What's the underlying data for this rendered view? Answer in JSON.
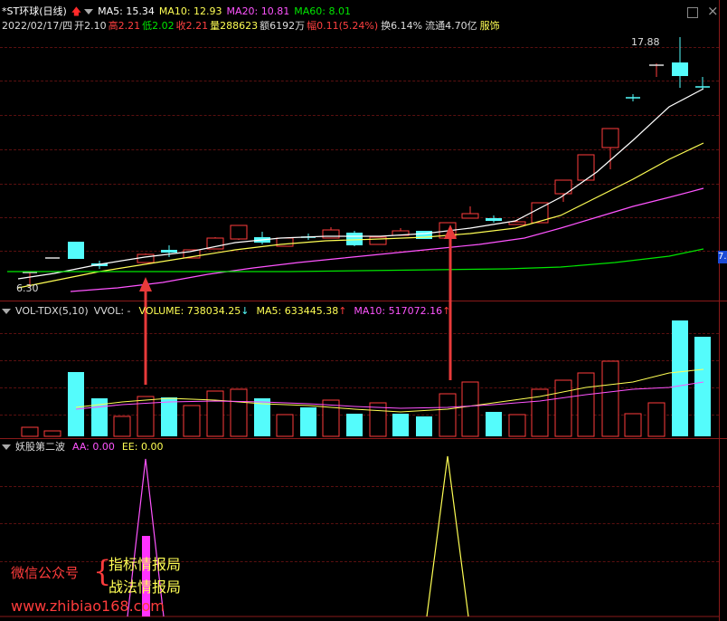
{
  "main": {
    "title": "*ST环球(日线)",
    "ma5": "MA5: 15.34",
    "ma10": "MA10: 12.93",
    "ma20": "MA20: 10.81",
    "ma60": "MA60: 8.01",
    "date": "2022/02/17/四",
    "open": "开2.10",
    "high": "高2.21",
    "low": "低2.02",
    "close": "收2.21",
    "volume": "量288623",
    "amount": "额6192万",
    "change": "幅0.11(5.24%)",
    "turnover": "换6.14%",
    "float": "流通4.70亿",
    "industry": "服饰",
    "high_label": "17.88",
    "low_label": "6.30",
    "right_price": "7."
  },
  "vol": {
    "title": "VOL-TDX(5,10)",
    "vvol": "VVOL: -",
    "volume": "VOLUME: 738034.25",
    "ma5": "MA5: 633445.38",
    "ma10": "MA10: 517072.16"
  },
  "ind": {
    "title": "妖股第二波",
    "aa": "AA: 0.00",
    "ee": "EE: 0.00"
  },
  "watermark": {
    "wechat": "微信公众号",
    "line1": "指标情报局",
    "line2": "战法情报局",
    "url": "www.zhibiao168.com"
  },
  "colors": {
    "up": "#ff3c3c",
    "down": "#54fcfc",
    "ma5": "#ffffff",
    "ma10": "#ffff54",
    "ma20": "#ff54ff",
    "ma60": "#00e600",
    "arrow": "#e83a3a"
  }
}
